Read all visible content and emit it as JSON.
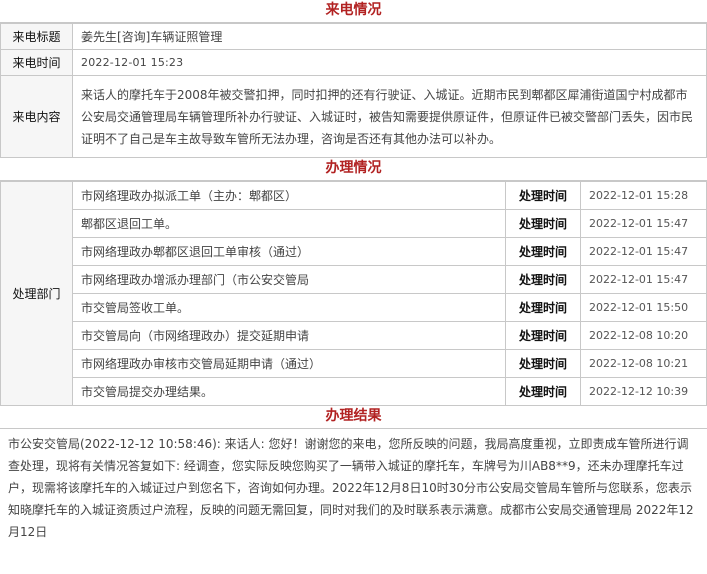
{
  "sections": {
    "call_info": "来电情况",
    "handling": "办理情况",
    "result": "办理结果"
  },
  "call": {
    "title_label": "来电标题",
    "title_value": "姜先生[咨询]车辆证照管理",
    "time_label": "来电时间",
    "time_value": "2022-12-01 15:23",
    "content_label": "来电内容",
    "content_value": "来话人的摩托车于2008年被交警扣押，同时扣押的还有行驶证、入城证。近期市民到郫都区犀浦街道国宁村成都市公安局交通管理局车辆管理所补办行驶证、入城证时，被告知需要提供原证件，但原证件已被交警部门丢失，因市民证明不了自己是车主故导致车管所无法办理，咨询是否还有其他办法可以补办。"
  },
  "handling": {
    "dept_label": "处理部门",
    "time_label": "处理时间",
    "rows": [
      {
        "desc": "市网络理政办拟派工单（主办：郫都区）",
        "time": "2022-12-01 15:28"
      },
      {
        "desc": "郫都区退回工单。",
        "time": "2022-12-01 15:47"
      },
      {
        "desc": "市网络理政办郫都区退回工单审核（通过）",
        "time": "2022-12-01 15:47"
      },
      {
        "desc": "市网络理政办增派办理部门（市公安交管局",
        "time": "2022-12-01 15:47"
      },
      {
        "desc": "市交管局签收工单。",
        "time": "2022-12-01 15:50"
      },
      {
        "desc": "市交管局向（市网络理政办）提交延期申请",
        "time": "2022-12-08 10:20"
      },
      {
        "desc": "市网络理政办审核市交管局延期申请（通过）",
        "time": "2022-12-08 10:21"
      },
      {
        "desc": "市交管局提交办理结果。",
        "time": "2022-12-12 10:39"
      }
    ]
  },
  "result": {
    "text": "市公安交管局(2022-12-12 10:58:46): 来话人: 您好！谢谢您的来电，您所反映的问题，我局高度重视，立即责成车管所进行调查处理，现将有关情况答复如下: 经调查，您实际反映您购买了一辆带入城证的摩托车，车牌号为川AB8**9，还未办理摩托车过户，现需将该摩托车的入城证过户到您名下，咨询如何办理。2022年12月8日10时30分市公安局交管局车管所与您联系，您表示知晓摩托车的入城证资质过户流程，反映的问题无需回复，同时对我们的及时联系表示满意。成都市公安局交通管理局 2022年12月12日"
  }
}
